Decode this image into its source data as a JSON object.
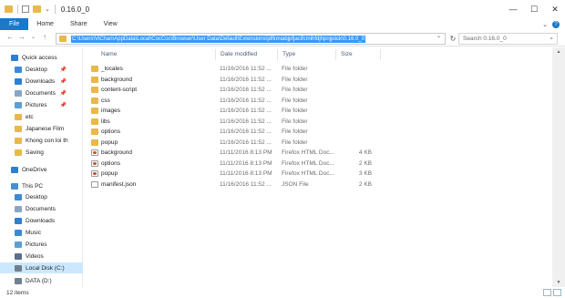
{
  "window": {
    "title": "0.16.0_0",
    "minimize_glyph": "—",
    "maximize_glyph": "☐",
    "close_glyph": "✕"
  },
  "ribbon": {
    "tabs": [
      "File",
      "Home",
      "Share",
      "View"
    ],
    "expand_glyph": "⌄",
    "help_glyph": "?"
  },
  "nav": {
    "back_glyph": "←",
    "forward_glyph": "→",
    "recent_glyph": "⌄",
    "up_glyph": "↑"
  },
  "address": {
    "path": "C:\\Users\\ViChan\\AppData\\Local\\CocCoc\\Browser\\User Data\\Default\\Extensions\\jdfkmiabjpfjacifcmihfdjhpnjpiick\\0.16.0_0",
    "dropdown_glyph": "⌄",
    "refresh_glyph": "↻"
  },
  "search": {
    "placeholder": "Search 0.16.0_0",
    "icon_glyph": "⌕"
  },
  "sidebar": {
    "items": [
      {
        "label": "Quick access",
        "icon": "star-icon",
        "color": "#2d7fd3",
        "pin": "",
        "exp": "",
        "indent": 6,
        "selected": false
      },
      {
        "label": "Desktop",
        "icon": "desktop-icon",
        "color": "#3b8ad8",
        "pin": "📌",
        "exp": "",
        "indent": 10,
        "selected": false
      },
      {
        "label": "Downloads",
        "icon": "download-icon",
        "color": "#2d7fd3",
        "pin": "📌",
        "exp": "",
        "indent": 10,
        "selected": false
      },
      {
        "label": "Documents",
        "icon": "documents-icon",
        "color": "#8aa6c4",
        "pin": "📌",
        "exp": "",
        "indent": 10,
        "selected": false
      },
      {
        "label": "Pictures",
        "icon": "pictures-icon",
        "color": "#5a9fd6",
        "pin": "📌",
        "exp": "",
        "indent": 10,
        "selected": false
      },
      {
        "label": "etc",
        "icon": "folder-icon",
        "color": "#e8b94a",
        "pin": "",
        "exp": "",
        "indent": 10,
        "selected": false
      },
      {
        "label": "Japanese Film",
        "icon": "folder-icon",
        "color": "#e8b94a",
        "pin": "",
        "exp": "",
        "indent": 10,
        "selected": false
      },
      {
        "label": "Khong con loi th",
        "icon": "folder-icon",
        "color": "#e8b94a",
        "pin": "",
        "exp": "",
        "indent": 10,
        "selected": false
      },
      {
        "label": "Saving",
        "icon": "folder-icon",
        "color": "#e8b94a",
        "pin": "",
        "exp": "",
        "indent": 10,
        "selected": false
      },
      {
        "label": "OneDrive",
        "icon": "cloud-icon",
        "color": "#2d7fd3",
        "pin": "",
        "exp": "",
        "indent": 6,
        "selected": false
      },
      {
        "label": "This PC",
        "icon": "computer-icon",
        "color": "#4a8fd0",
        "pin": "",
        "exp": "",
        "indent": 6,
        "selected": false
      },
      {
        "label": "Desktop",
        "icon": "desktop-icon",
        "color": "#3b8ad8",
        "pin": "",
        "exp": "",
        "indent": 10,
        "selected": false
      },
      {
        "label": "Documents",
        "icon": "documents-icon",
        "color": "#8aa6c4",
        "pin": "",
        "exp": "",
        "indent": 10,
        "selected": false
      },
      {
        "label": "Downloads",
        "icon": "download-icon",
        "color": "#2d7fd3",
        "pin": "",
        "exp": "",
        "indent": 10,
        "selected": false
      },
      {
        "label": "Music",
        "icon": "music-icon",
        "color": "#3b8ad8",
        "pin": "",
        "exp": "",
        "indent": 10,
        "selected": false
      },
      {
        "label": "Pictures",
        "icon": "pictures-icon",
        "color": "#5a9fd6",
        "pin": "",
        "exp": "",
        "indent": 10,
        "selected": false
      },
      {
        "label": "Videos",
        "icon": "videos-icon",
        "color": "#5a6f8c",
        "pin": "",
        "exp": "",
        "indent": 10,
        "selected": false
      },
      {
        "label": "Local Disk (C:)",
        "icon": "drive-icon",
        "color": "#6f7f90",
        "pin": "",
        "exp": "",
        "indent": 10,
        "selected": true
      },
      {
        "label": "DATA (D:)",
        "icon": "drive-icon",
        "color": "#6f7f90",
        "pin": "",
        "exp": "",
        "indent": 10,
        "selected": false
      }
    ]
  },
  "columns": {
    "name": "Name",
    "date": "Date modified",
    "type": "Type",
    "size": "Size"
  },
  "files": [
    {
      "name": "_locales",
      "date": "11/16/2016 11:52 ...",
      "type": "File folder",
      "size": "",
      "kind": "folder"
    },
    {
      "name": "background",
      "date": "11/16/2016 11:52 ...",
      "type": "File folder",
      "size": "",
      "kind": "folder"
    },
    {
      "name": "content-script",
      "date": "11/16/2016 11:52 ...",
      "type": "File folder",
      "size": "",
      "kind": "folder"
    },
    {
      "name": "css",
      "date": "11/16/2016 11:52 ...",
      "type": "File folder",
      "size": "",
      "kind": "folder"
    },
    {
      "name": "images",
      "date": "11/16/2016 11:52 ...",
      "type": "File folder",
      "size": "",
      "kind": "folder"
    },
    {
      "name": "libs",
      "date": "11/16/2016 11:52 ...",
      "type": "File folder",
      "size": "",
      "kind": "folder"
    },
    {
      "name": "options",
      "date": "11/16/2016 11:52 ...",
      "type": "File folder",
      "size": "",
      "kind": "folder"
    },
    {
      "name": "popup",
      "date": "11/16/2016 11:52 ...",
      "type": "File folder",
      "size": "",
      "kind": "folder"
    },
    {
      "name": "background",
      "date": "11/11/2016 8:13 PM",
      "type": "Firefox HTML Doc...",
      "size": "4 KB",
      "kind": "html"
    },
    {
      "name": "options",
      "date": "11/11/2016 8:13 PM",
      "type": "Firefox HTML Doc...",
      "size": "2 KB",
      "kind": "html"
    },
    {
      "name": "popup",
      "date": "11/11/2016 8:13 PM",
      "type": "Firefox HTML Doc...",
      "size": "3 KB",
      "kind": "html"
    },
    {
      "name": "manifest.json",
      "date": "11/16/2016 11:52 ...",
      "type": "JSON File",
      "size": "2 KB",
      "kind": "json"
    }
  ],
  "status": {
    "count": "12 items"
  },
  "scrollbar": {
    "up_glyph": "▲",
    "down_glyph": "▼"
  }
}
